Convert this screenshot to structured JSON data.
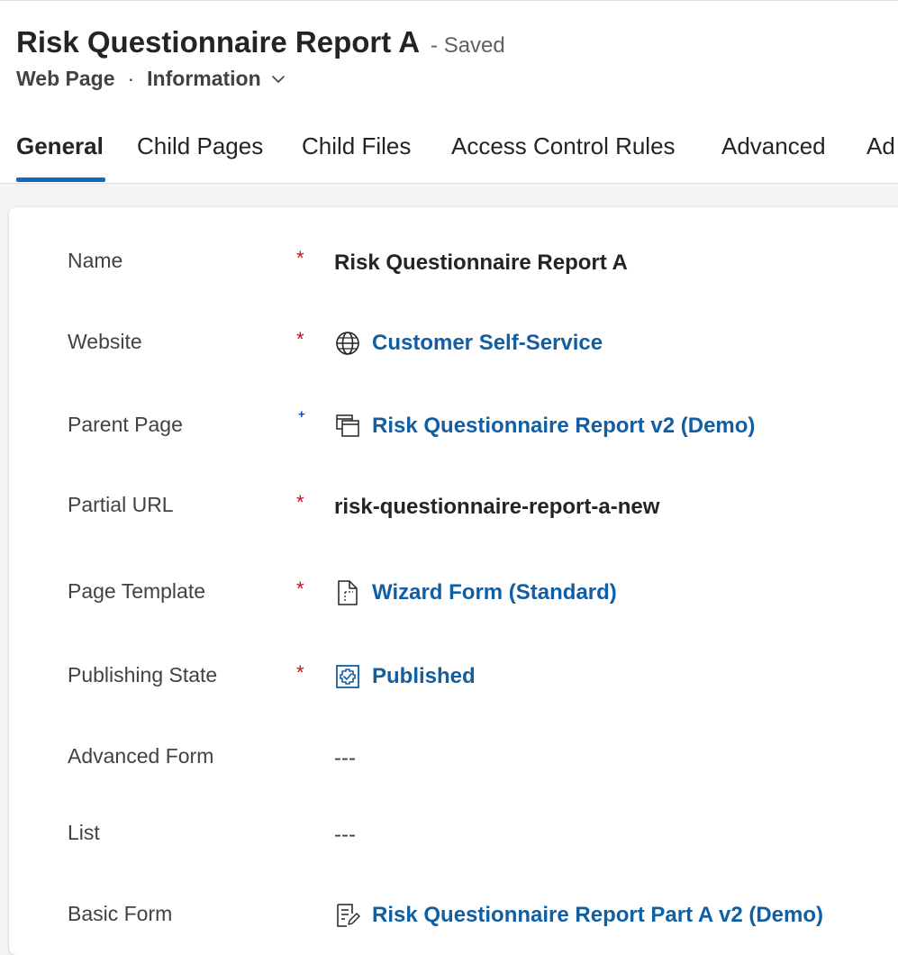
{
  "header": {
    "title": "Risk Questionnaire Report A",
    "saved_status": "- Saved",
    "entity": "Web Page",
    "separator": "·",
    "form_selector": "Information"
  },
  "tabs": [
    {
      "label": "General",
      "active": true
    },
    {
      "label": "Child Pages",
      "active": false
    },
    {
      "label": "Child Files",
      "active": false
    },
    {
      "label": "Access Control Rules",
      "active": false
    },
    {
      "label": "Advanced",
      "active": false
    },
    {
      "label": "Ad",
      "active": false
    }
  ],
  "fields": {
    "name": {
      "label": "Name",
      "marker": "*",
      "value": "Risk Questionnaire Report A"
    },
    "website": {
      "label": "Website",
      "marker": "*",
      "value": "Customer Self-Service",
      "icon": "globe-icon"
    },
    "parent_page": {
      "label": "Parent Page",
      "marker": "+",
      "value": "Risk Questionnaire Report v2 (Demo)",
      "icon": "stacked-pages-icon"
    },
    "partial_url": {
      "label": "Partial URL",
      "marker": "*",
      "value": "risk-questionnaire-report-a-new"
    },
    "page_template": {
      "label": "Page Template",
      "marker": "*",
      "value": "Wizard Form (Standard)",
      "icon": "page-template-icon"
    },
    "publishing_state": {
      "label": "Publishing State",
      "marker": "*",
      "value": "Published",
      "icon": "publishing-state-icon"
    },
    "advanced_form": {
      "label": "Advanced Form",
      "value": "---"
    },
    "list": {
      "label": "List",
      "value": "---"
    },
    "basic_form": {
      "label": "Basic Form",
      "value": "Risk Questionnaire Report Part A v2 (Demo)",
      "icon": "form-edit-icon"
    }
  },
  "colors": {
    "accent": "#0f6cbd",
    "link": "#115ea3",
    "required": "#c50f1f",
    "recommended": "#0f3cc9"
  }
}
